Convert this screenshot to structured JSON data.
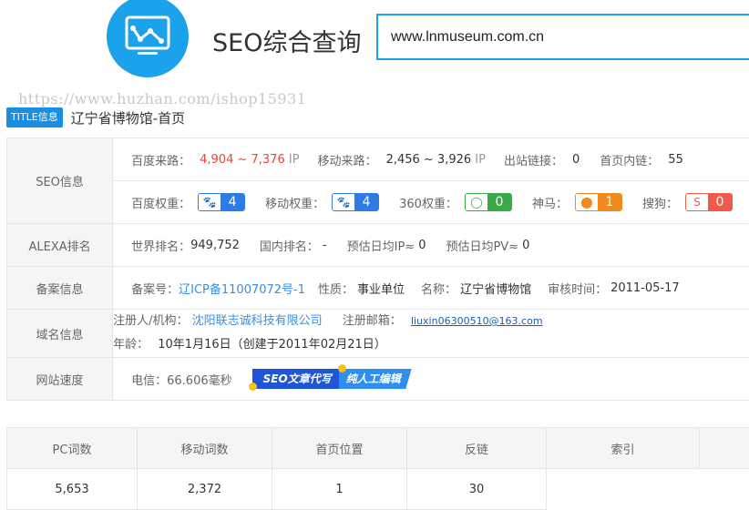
{
  "header": {
    "title": "SEO综合查询",
    "search_value": "www.lnmuseum.com.cn"
  },
  "watermark": "https://www.huzhan.com/ishop15931",
  "title_info": {
    "badge": "TITLE信息",
    "text": "辽宁省博物馆-首页"
  },
  "seo": {
    "label": "SEO信息",
    "baidu_traffic_label": "百度来路：",
    "baidu_traffic_value": "4,904 ~ 7,376",
    "baidu_traffic_unit": "IP",
    "mobile_traffic_label": "移动来路：",
    "mobile_traffic_value": "2,456 ~ 3,926",
    "mobile_traffic_unit": "IP",
    "outlinks_label": "出站链接：",
    "outlinks_value": "0",
    "innerlinks_label": "首页内链：",
    "innerlinks_value": "55",
    "weights": [
      {
        "label": "百度权重：",
        "value": "4",
        "icon": "baidu-paw-icon",
        "color": "#2d7be5"
      },
      {
        "label": "移动权重：",
        "value": "4",
        "icon": "mobile-paw-icon",
        "color": "#2d7be5"
      },
      {
        "label": "360权重：",
        "value": "0",
        "icon": "360-icon",
        "color": "#3aaa48"
      },
      {
        "label": "神马：",
        "value": "1",
        "icon": "shenma-icon",
        "color": "#f08a1c"
      },
      {
        "label": "搜狗：",
        "value": "0",
        "icon": "sogou-icon",
        "color": "#ef5a4a"
      }
    ]
  },
  "alexa": {
    "label": "ALEXA排名",
    "world_label": "世界排名：",
    "world_value": "949,752",
    "domestic_label": "国内排名：",
    "domestic_value": "-",
    "ip_label": "预估日均IP≈",
    "ip_value": "0",
    "pv_label": "预估日均PV≈",
    "pv_value": "0"
  },
  "icp": {
    "label": "备案信息",
    "number_label": "备案号：",
    "number_value": "辽ICP备11007072号-1",
    "nature_label": "性质：",
    "nature_value": "事业单位",
    "name_label": "名称：",
    "name_value": "辽宁省博物馆",
    "date_label": "审核时间：",
    "date_value": "2011-05-17"
  },
  "domain": {
    "label": "域名信息",
    "registrant_label": "注册人/机构：",
    "registrant_value": "沈阳联志诚科技有限公司",
    "email_label": "注册邮箱：",
    "email_value": "liuxin06300510@163.com",
    "age_label": "年龄：",
    "age_value": "10年1月16日（创建于2011年02月21日）"
  },
  "speed": {
    "label": "网站速度",
    "telecom_label": "电信：",
    "telecom_value": "66.606毫秒",
    "promo_part1": "SEO文章代写",
    "promo_part2": "纯人工编辑"
  },
  "stats": {
    "headers": [
      "PC词数",
      "移动词数",
      "首页位置",
      "反链",
      "索引",
      ""
    ],
    "values": [
      "5,653",
      "2,372",
      "1",
      "30",
      "",
      ""
    ]
  },
  "colors": {
    "accent": "#1aa2ea",
    "traffic_red": "#ee4433"
  }
}
